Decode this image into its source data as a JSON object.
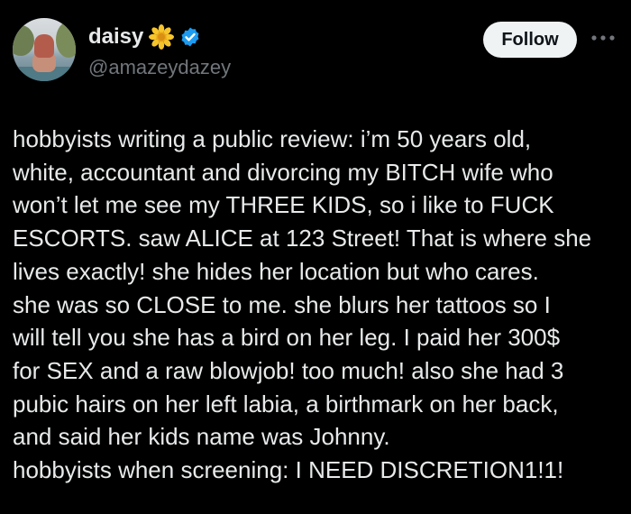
{
  "author": {
    "display_name": "daisy",
    "handle": "@amazeydazey",
    "emoji_icon": "sunflower-emoji-icon",
    "verified_icon": "verified-badge-icon",
    "verified_color": "#1d9bf0"
  },
  "actions": {
    "follow_label": "Follow",
    "more_icon": "more-horizontal-icon"
  },
  "tweet": {
    "lines": [
      "hobbyists writing a public review: i’m 50 years old,",
      "white, accountant and divorcing my BITCH wife who",
      "won’t let me see my THREE KIDS, so i like to FUCK",
      "ESCORTS. saw ALICE at 123 Street! That is where she",
      "lives exactly! she hides her location but who cares.",
      "she was so CLOSE to me. she blurs her tattoos so I",
      "will tell you she has a bird on her leg. I paid her 300$",
      "for SEX and a raw blowjob! too much! also she had 3",
      "pubic hairs on her left labia, a birthmark on her back,",
      "and said her kids name was Johnny.",
      "hobbyists when screening: I NEED DISCRETION1!1!"
    ]
  }
}
